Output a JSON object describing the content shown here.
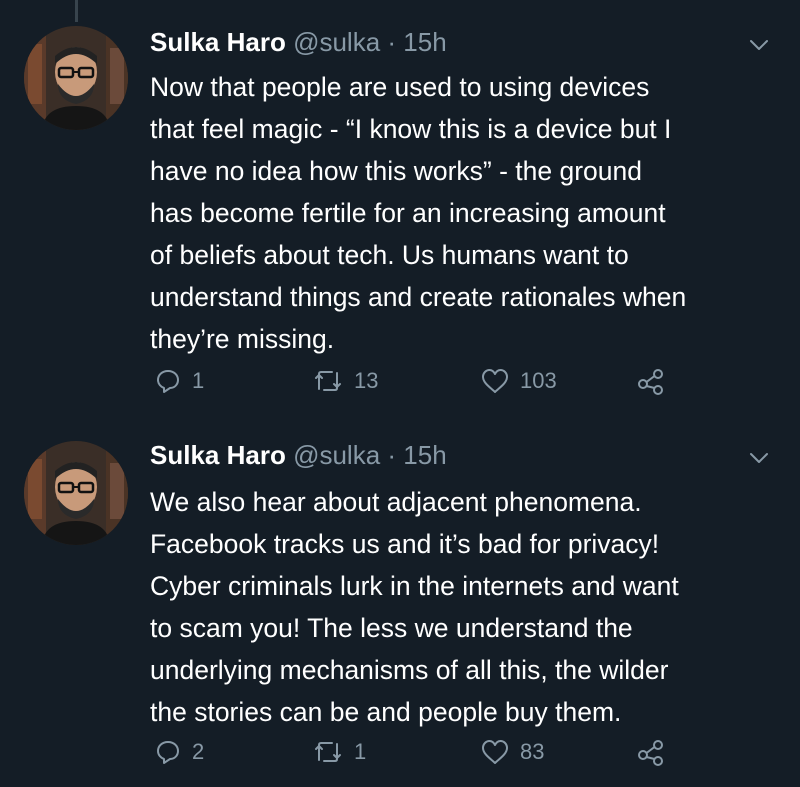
{
  "colors": {
    "background": "#141d26",
    "primary_text": "#ffffff",
    "secondary_text": "#8899a6",
    "thread_line": "#38444d"
  },
  "tweets": [
    {
      "author_name": "Sulka Haro",
      "handle": "@sulka",
      "separator": "·",
      "time": "15h",
      "avatar": "avatar-photo",
      "menu_icon": "chevron-down-icon",
      "text_lines": [
        "Now that people are used to using devices",
        "that feel magic - “I know this is a device but I",
        "have no idea how this works” - the ground",
        "has become fertile for an increasing amount",
        "of beliefs about tech. Us humans want to",
        "understand things and create rationales when",
        "they’re missing."
      ],
      "replies": "1",
      "retweets": "13",
      "likes": "103",
      "icons": [
        "reply-icon",
        "retweet-icon",
        "like-icon",
        "share-icon"
      ]
    },
    {
      "author_name": "Sulka Haro",
      "handle": "@sulka",
      "separator": "·",
      "time": "15h",
      "avatar": "avatar-photo",
      "menu_icon": "chevron-down-icon",
      "text_lines": [
        "We also hear about adjacent phenomena.",
        "Facebook tracks us and it’s bad for privacy!",
        "Cyber criminals lurk in the internets and want",
        "to scam you! The less we understand the",
        "underlying mechanisms of all this, the wilder",
        "the stories can be and people buy them."
      ],
      "replies": "2",
      "retweets": "1",
      "likes": "83",
      "icons": [
        "reply-icon",
        "retweet-icon",
        "like-icon",
        "share-icon"
      ]
    }
  ]
}
